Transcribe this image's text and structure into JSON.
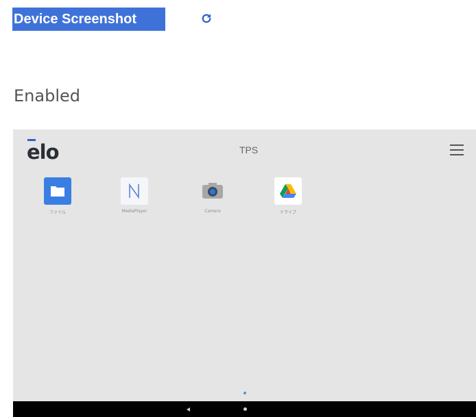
{
  "header": {
    "title": "Device Screenshot",
    "refresh_icon": "refresh-icon",
    "accent_color": "#3f72d9"
  },
  "status": {
    "text": "Enabled"
  },
  "device_screen": {
    "logo_text": "elo",
    "title": "TPS",
    "menu_icon": "hamburger-menu-icon",
    "apps": [
      {
        "label": "ファイル",
        "icon": "files-folder-icon"
      },
      {
        "label": "MediaPlayer",
        "icon": "n-app-icon"
      },
      {
        "label": "Camera",
        "icon": "camera-icon"
      },
      {
        "label": "ドライブ",
        "icon": "google-drive-icon"
      }
    ],
    "nav": {
      "back_icon": "back-triangle-icon",
      "home_icon": "home-dot-icon"
    }
  }
}
